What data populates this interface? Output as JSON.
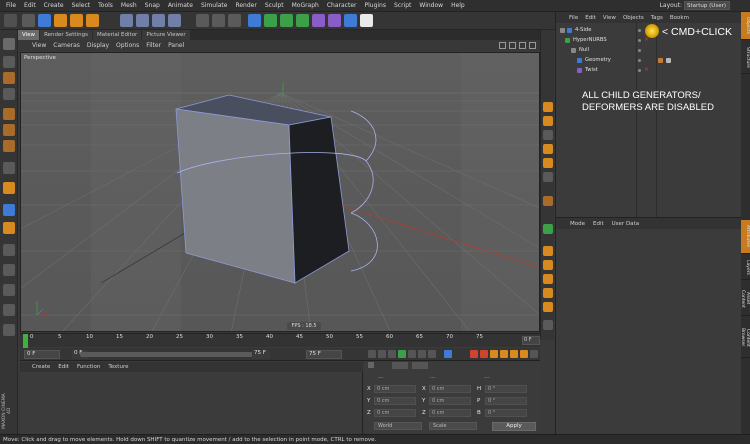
{
  "menubar": {
    "items": [
      "File",
      "Edit",
      "Create",
      "Select",
      "Tools",
      "Mesh",
      "Snap",
      "Animate",
      "Simulate",
      "Render",
      "Sculpt",
      "MoGraph",
      "Character",
      "Plugins",
      "Script",
      "Window",
      "Help"
    ],
    "layout_label": "Layout:",
    "layout_value": "Startup (User)"
  },
  "viewport": {
    "tabs": [
      "View",
      "Render Settings",
      "Material Editor",
      "Picture Viewer"
    ],
    "active_tab": "View",
    "menu": [
      "View",
      "Cameras",
      "Display",
      "Options",
      "Filter",
      "Panel"
    ],
    "camera_label": "Perspective",
    "fps": "FPS : 18.5"
  },
  "object_manager": {
    "menu": [
      "File",
      "Edit",
      "View",
      "Objects",
      "Tags",
      "Bookm"
    ],
    "objects": [
      {
        "name": "4-Side",
        "indent": 0
      },
      {
        "name": "HyperNURBS",
        "indent": 1
      },
      {
        "name": "Null",
        "indent": 2
      },
      {
        "name": "Geometry",
        "indent": 3
      },
      {
        "name": "Twist",
        "indent": 3
      }
    ],
    "annotation_click": "< CMD+CLICK",
    "annotation_disabled": "ALL CHILD GENERATORS/ DEFORMERS ARE DISABLED"
  },
  "attribute_manager": {
    "menu": [
      "Mode",
      "Edit",
      "User Data"
    ]
  },
  "right_tabs": [
    "Objects",
    "Structure",
    "Attributes",
    "Layers",
    "Asset Content",
    "Content Browser"
  ],
  "timeline": {
    "ticks": [
      "0",
      "5",
      "10",
      "15",
      "20",
      "25",
      "30",
      "35",
      "40",
      "45",
      "50",
      "55",
      "60",
      "65",
      "70",
      "75"
    ],
    "frame_right": "0 F"
  },
  "transport": {
    "current_frame": "0 F",
    "slider_value": "0 F",
    "end_field": "75 F",
    "max_field": "75 F"
  },
  "material_manager": {
    "menu": [
      "Create",
      "Edit",
      "Function",
      "Texture"
    ]
  },
  "coordinates": {
    "headers": [
      "---",
      "---",
      "---"
    ],
    "rows": [
      {
        "a": "X",
        "av": "0 cm",
        "b": "X",
        "bv": "0 cm",
        "c": "H",
        "cv": "0 °"
      },
      {
        "a": "Y",
        "av": "0 cm",
        "b": "Y",
        "bv": "0 cm",
        "c": "P",
        "cv": "0 °"
      },
      {
        "a": "Z",
        "av": "0 cm",
        "b": "Z",
        "bv": "0 cm",
        "c": "B",
        "cv": "0 °"
      }
    ],
    "world_select": "World",
    "scale_select": "Scale",
    "apply_label": "Apply"
  },
  "statusbar": {
    "text": "Move: Click and drag to move elements. Hold down SHIFT to quantize movement / add to the selection in point mode, CTRL to remove."
  },
  "brand": {
    "logo_text": "MAXON CINEMA 4D"
  },
  "colors": {
    "accent_blue": "#3d7bd6",
    "playhead_green": "#3fb03f",
    "marker_yellow": "#ffd23a"
  }
}
